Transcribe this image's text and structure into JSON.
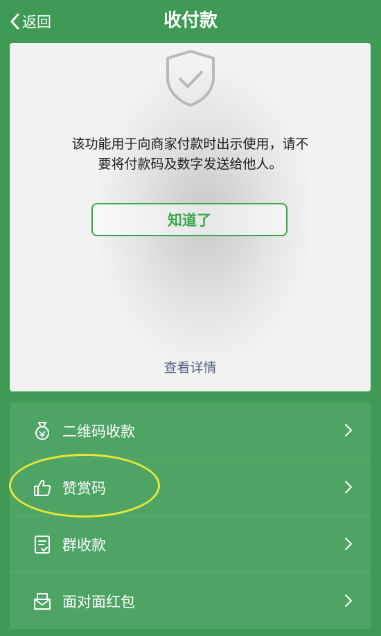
{
  "navbar": {
    "back_label": "返回",
    "title": "收付款"
  },
  "dialog": {
    "icon": "shield-check-icon",
    "message_line1": "该功能用于向商家付款时出示使用，请不",
    "message_line2": "要将付款码及数字发送给他人。",
    "confirm_label": "知道了",
    "details_link": "查看详情"
  },
  "menu": {
    "items": [
      {
        "label": "二维码收款",
        "icon": "money-bag-icon"
      },
      {
        "label": "赞赏码",
        "icon": "thumbs-up-icon"
      },
      {
        "label": "群收款",
        "icon": "group-receipt-icon"
      },
      {
        "label": "面对面红包",
        "icon": "red-packet-icon"
      }
    ]
  },
  "colors": {
    "background": "#3f9a55",
    "menu_background": "#4ea464",
    "accent_green": "#3aa64a",
    "highlight_circle": "#e8e636",
    "link": "#55617f"
  }
}
